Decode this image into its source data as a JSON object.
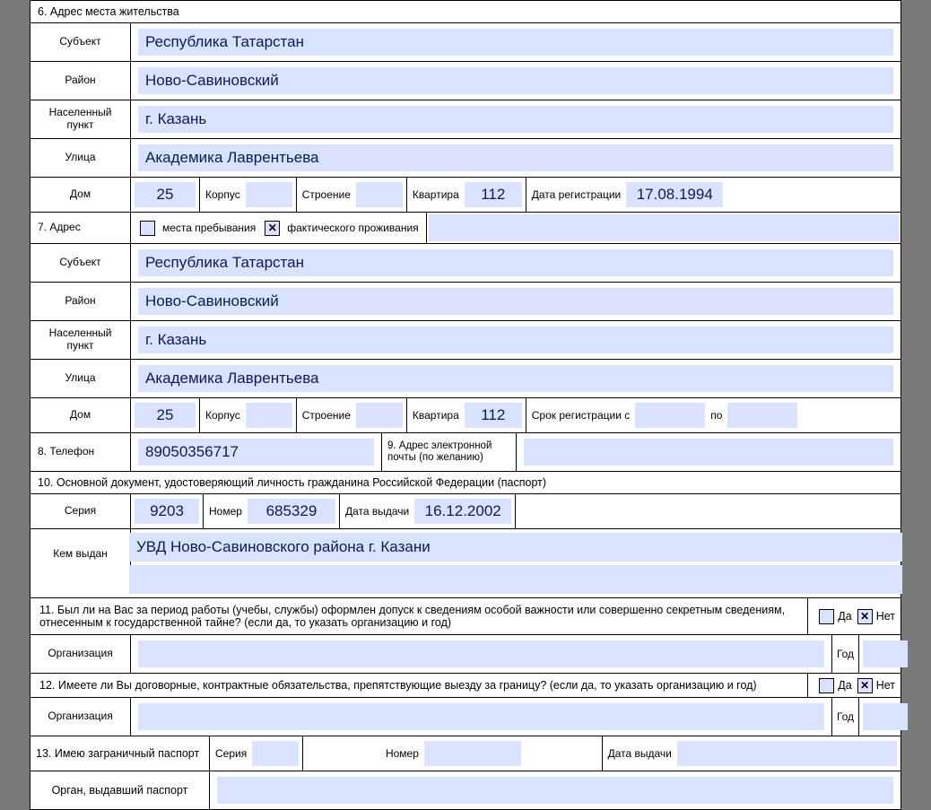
{
  "section6": {
    "title": "6. Адрес места жительства",
    "labels": {
      "subject": "Субъект",
      "district": "Район",
      "locality": "Населенный пункт",
      "street": "Улица",
      "house": "Дом",
      "korpus": "Корпус",
      "building": "Строение",
      "flat": "Квартира",
      "regdate": "Дата регистрации"
    },
    "subject": "Республика Татарстан",
    "district": "Ново-Савиновский",
    "locality": "г. Казань",
    "street": "Академика Лаврентьева",
    "house": "25",
    "korpus": "",
    "building": "",
    "flat": "112",
    "regdate": "17.08.1994"
  },
  "section7": {
    "title": "7. Адрес",
    "stay_label": "места пребывания",
    "actual_label": "фактического проживания",
    "stay_checked": false,
    "actual_checked": true,
    "labels": {
      "subject": "Субъект",
      "district": "Район",
      "locality": "Населенный пункт",
      "street": "Улица",
      "house": "Дом",
      "korpus": "Корпус",
      "building": "Строение",
      "flat": "Квартира",
      "regperiod": "Срок регистрации с",
      "to": "по"
    },
    "subject": "Республика Татарстан",
    "district": "Ново-Савиновский",
    "locality": "г. Казань",
    "street": "Академика Лаврентьева",
    "house": "25",
    "korpus": "",
    "building": "",
    "flat": "112",
    "regfrom": "",
    "regto": ""
  },
  "section8": {
    "label": "8. Телефон",
    "value": "89050356717"
  },
  "section9": {
    "label": "9. Адрес электронной почты (по желанию)",
    "value": ""
  },
  "section10": {
    "title": "10. Основной документ, удостоверяющий личность гражданина Российской Федерации (паспорт)",
    "labels": {
      "series": "Серия",
      "number": "Номер",
      "issue_date": "Дата выдачи",
      "issued_by": "Кем выдан"
    },
    "series": "9203",
    "number": "685329",
    "issue_date": "16.12.2002",
    "issued_by": "УВД Ново-Савиновского района г. Казани"
  },
  "section11": {
    "question": "11. Был ли на Вас за период работы (учебы, службы) оформлен допуск к сведениям особой важности или совершенно секретным сведениям, отнесенным к государственной тайне? (если да, то указать организацию и год)",
    "yes": "Да",
    "no": "Нет",
    "yes_checked": false,
    "no_checked": true,
    "org_label": "Организация",
    "year_label": "Год",
    "org": "",
    "year": ""
  },
  "section12": {
    "question": "12. Имеете ли Вы договорные, контрактные обязательства, препятствующие выезду за границу? (если да, то указать организацию и год)",
    "yes": "Да",
    "no": "Нет",
    "yes_checked": false,
    "no_checked": true,
    "org_label": "Организация",
    "year_label": "Год",
    "org": "",
    "year": ""
  },
  "section13": {
    "title": "13. Имею заграничный паспорт",
    "labels": {
      "series": "Серия",
      "number": "Номер",
      "issue_date": "Дата выдачи",
      "issued_by": "Орган, выдавший паспорт"
    },
    "series": "",
    "number": "",
    "issue_date": "",
    "issued_by": ""
  }
}
